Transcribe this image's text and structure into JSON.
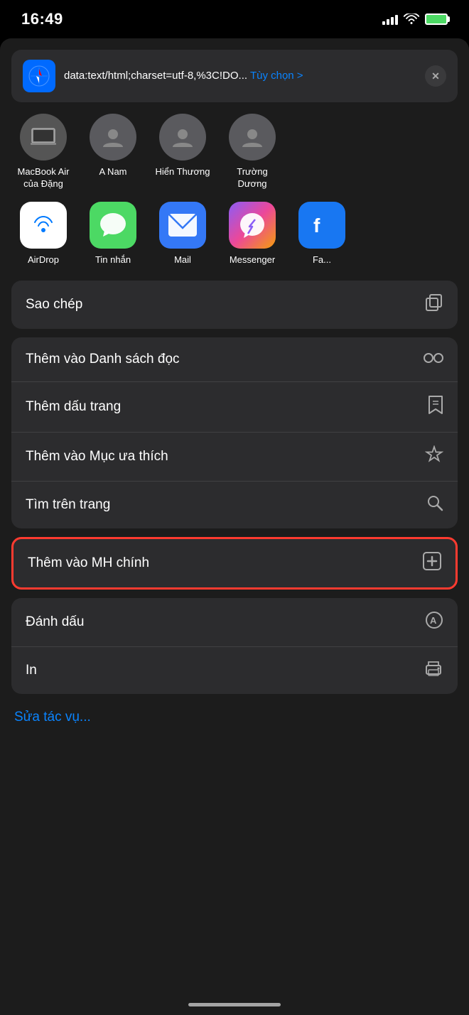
{
  "statusBar": {
    "time": "16:49"
  },
  "urlBar": {
    "safariEmoji": "🧭",
    "urlText": "data:text/html;charset=utf-8,%3C!DO...",
    "optionsText": "Tùy chọn >",
    "closeLabel": "×"
  },
  "contacts": [
    {
      "name": "MacBook Air của Đặng",
      "initials": "💻"
    },
    {
      "name": "A Nam",
      "initials": "👤"
    },
    {
      "name": "Hiển Thương",
      "initials": "👤"
    },
    {
      "name": "Trường Dương",
      "initials": "👤"
    }
  ],
  "apps": [
    {
      "name": "AirDrop",
      "type": "airdrop"
    },
    {
      "name": "Tin nhắn",
      "type": "messages"
    },
    {
      "name": "Mail",
      "type": "mail"
    },
    {
      "name": "Messenger",
      "type": "messenger"
    },
    {
      "name": "Fa...",
      "type": "other"
    }
  ],
  "menuItems": [
    {
      "id": "sao-chep",
      "label": "Sao chép",
      "icon": "copy"
    },
    {
      "id": "them-danh-sach",
      "label": "Thêm vào Danh sách đọc",
      "icon": "reading"
    },
    {
      "id": "them-dau-trang",
      "label": "Thêm dấu trang",
      "icon": "bookmark"
    },
    {
      "id": "them-muc",
      "label": "Thêm vào Mục ưa thích",
      "icon": "star"
    },
    {
      "id": "tim-trang",
      "label": "Tìm trên trang",
      "icon": "search"
    }
  ],
  "highlightedItem": {
    "id": "them-mh-chinh",
    "label": "Thêm vào MH chính",
    "icon": "add-square"
  },
  "bottomMenuItems": [
    {
      "id": "danh-dau",
      "label": "Đánh dấu",
      "icon": "markup"
    },
    {
      "id": "in",
      "label": "In",
      "icon": "print"
    }
  ],
  "editActionsLabel": "Sửa tác vụ...",
  "icons": {
    "copy": "⧉",
    "reading": "◎",
    "bookmark": "📖",
    "star": "☆",
    "search": "🔍",
    "add-square": "⊞",
    "markup": "Ⓐ",
    "print": "🖨"
  }
}
